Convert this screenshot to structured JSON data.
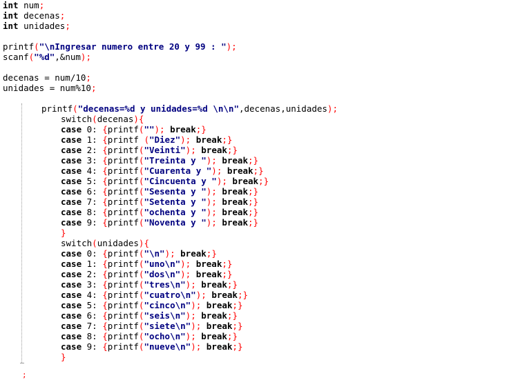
{
  "code_lines": [
    "int num;",
    "int decenas;",
    "int unidades;",
    "",
    "printf(\"\\nIngresar numero entre 20 y 99 : \");",
    "scanf(\"%d\",&num);",
    "",
    "decenas = num/10;",
    "unidades = num%10;",
    "",
    "printf(\"decenas=%d y unidades=%d \\n\\n\",decenas,unidades);",
    "switch(decenas){",
    "case 0: {printf(\"\"); break;}",
    "case 1: {printf (\"Diez\"); break;}",
    "case 2: {printf(\"Veinti\"); break;}",
    "case 3: {printf(\"Treinta y \"); break;}",
    "case 4: {printf(\"Cuarenta y \"); break;}",
    "case 5: {printf(\"Cincuenta y \"); break;}",
    "case 6: {printf(\"Sesenta y \"); break;}",
    "case 7: {printf(\"Setenta y \"); break;}",
    "case 8: {printf(\"ochenta y \"); break;}",
    "case 9: {printf(\"Noventa y \"); break;}",
    "}",
    "switch(unidades){",
    "case 0: {printf(\"\\n\"); break;}",
    "case 1: {printf(\"uno\\n\"); break;}",
    "case 2: {printf(\"dos\\n\"); break;}",
    "case 3: {printf(\"tres\\n\"); break;}",
    "case 4: {printf(\"cuatro\\n\"); break;}",
    "case 5: {printf(\"cinco\\n\"); break;}",
    "case 6: {printf(\"seis\\n\"); break;}",
    "case 7: {printf(\"siete\\n\"); break;}",
    "case 8: {printf(\"ocho\\n\"); break;}",
    "case 9: {printf(\"nueve\\n\"); break;}",
    "}"
  ],
  "trailing_glyph": ";"
}
